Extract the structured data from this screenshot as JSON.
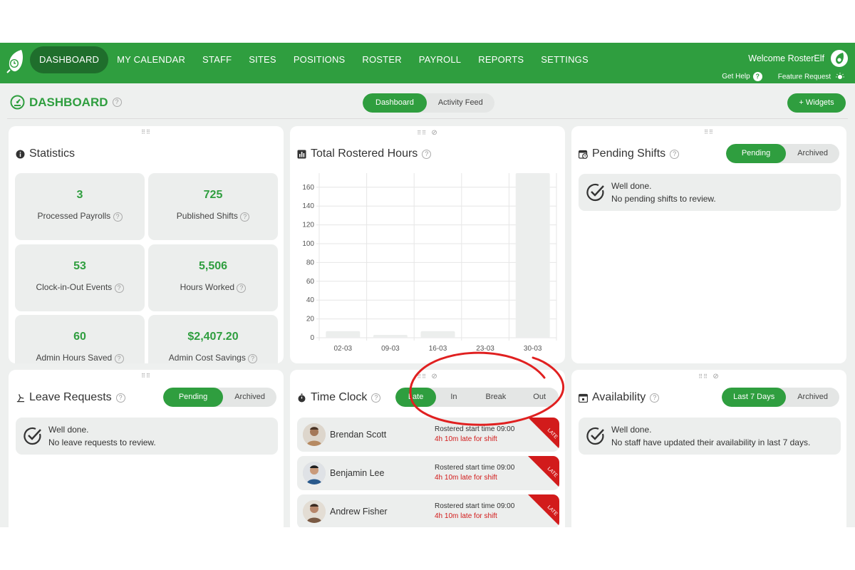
{
  "nav": {
    "items": [
      "DASHBOARD",
      "MY CALENDAR",
      "STAFF",
      "SITES",
      "POSITIONS",
      "ROSTER",
      "PAYROLL",
      "REPORTS",
      "SETTINGS"
    ],
    "welcome": "Welcome RosterElf",
    "get_help": "Get Help",
    "feature_request": "Feature Request"
  },
  "header": {
    "title": "DASHBOARD",
    "tabs": [
      "Dashboard",
      "Activity Feed"
    ],
    "widgets_button": "+ Widgets"
  },
  "statistics": {
    "title": "Statistics",
    "items": [
      {
        "value": "3",
        "label": "Processed Payrolls"
      },
      {
        "value": "725",
        "label": "Published Shifts"
      },
      {
        "value": "53",
        "label": "Clock-in-Out Events"
      },
      {
        "value": "5,506",
        "label": "Hours Worked"
      },
      {
        "value": "60",
        "label": "Admin Hours Saved"
      },
      {
        "value": "$2,407.20",
        "label": "Admin Cost Savings"
      }
    ]
  },
  "rostered_hours": {
    "title": "Total Rostered Hours"
  },
  "chart_data": {
    "type": "bar",
    "categories": [
      "02-03",
      "09-03",
      "16-03",
      "23-03",
      "30-03"
    ],
    "values": [
      7,
      3,
      7,
      0,
      175
    ],
    "title": "Total Rostered Hours",
    "xlabel": "",
    "ylabel": "",
    "ylim": [
      0,
      175
    ],
    "yticks": [
      0,
      20,
      40,
      60,
      80,
      100,
      120,
      140,
      160
    ],
    "grid": true,
    "color": "#eceeed"
  },
  "pending_shifts": {
    "title": "Pending Shifts",
    "tabs": [
      "Pending",
      "Archived"
    ],
    "line1": "Well done.",
    "line2": "No pending shifts to review."
  },
  "leave_requests": {
    "title": "Leave Requests",
    "tabs": [
      "Pending",
      "Archived"
    ],
    "line1": "Well done.",
    "line2": "No leave requests to review."
  },
  "time_clock": {
    "title": "Time Clock",
    "tabs": [
      "Late",
      "In",
      "Break",
      "Out"
    ],
    "ribbon": "LATE",
    "rows": [
      {
        "name": "Brendan Scott",
        "rostered": "Rostered start time 09:00",
        "late": "4h 10m late for shift"
      },
      {
        "name": "Benjamin Lee",
        "rostered": "Rostered start time 09:00",
        "late": "4h 10m late for shift"
      },
      {
        "name": "Andrew Fisher",
        "rostered": "Rostered start time 09:00",
        "late": "4h 10m late for shift"
      }
    ]
  },
  "availability": {
    "title": "Availability",
    "tabs": [
      "Last 7 Days",
      "Archived"
    ],
    "line1": "Well done.",
    "line2": "No staff have updated their availability in last 7 days."
  },
  "colors": {
    "brand": "#2f9e3f",
    "brand_dark": "#1f6e2c",
    "late_red": "#d21b1b",
    "annotation": "#e02020"
  }
}
